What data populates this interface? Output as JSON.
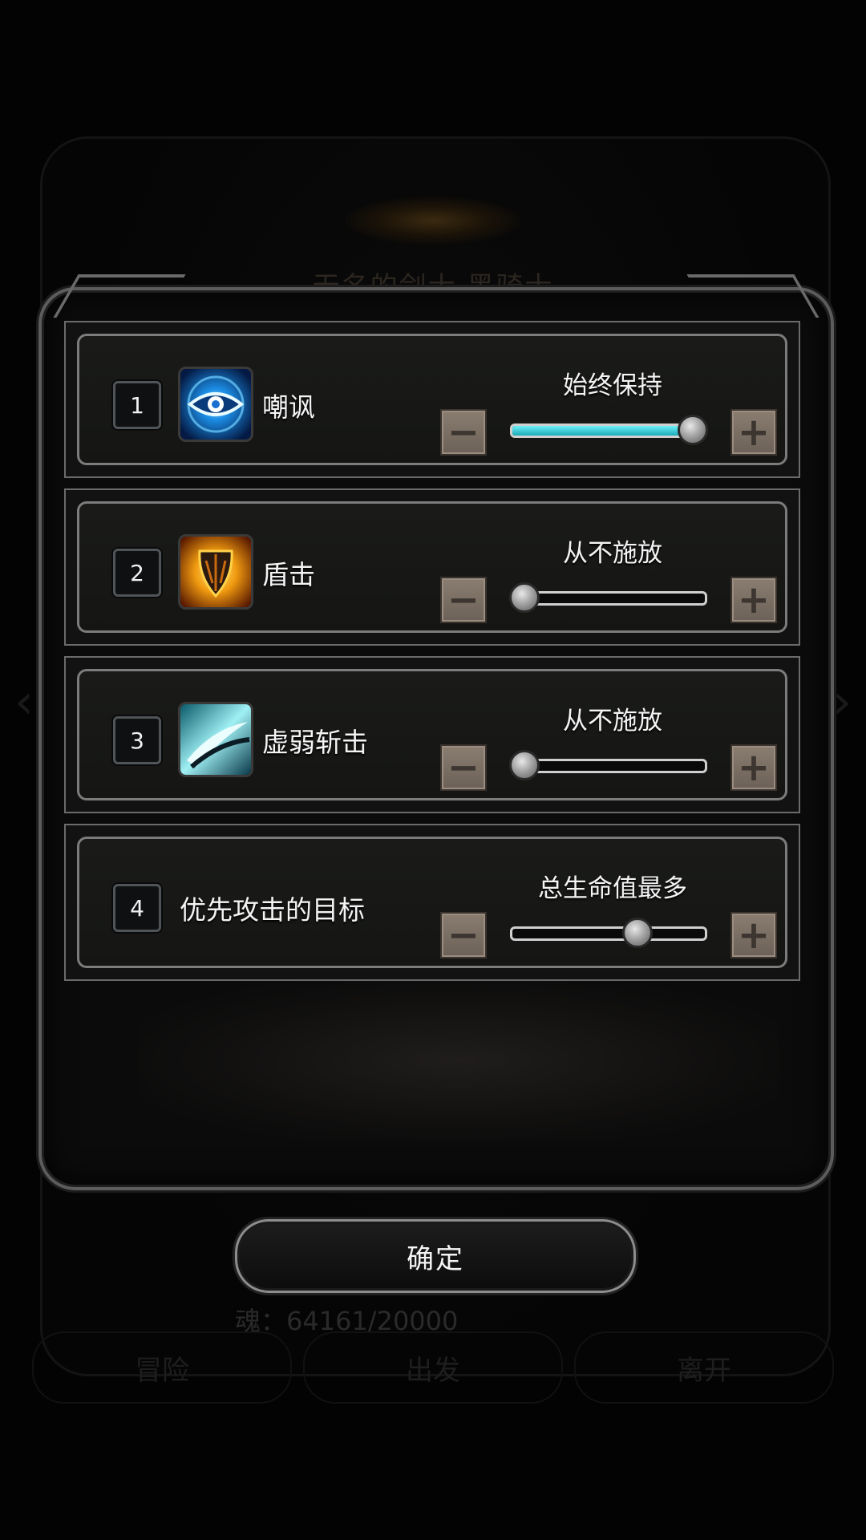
{
  "background": {
    "title": "无名的剑士 黑骑士",
    "souls": "魂：64161/20000",
    "nav": [
      "冒险",
      "出发",
      "离开"
    ]
  },
  "settings": [
    {
      "number": "1",
      "icon": "taunt-eye-icon",
      "name": "嘲讽",
      "value_label": "始终保持",
      "level": 1.0
    },
    {
      "number": "2",
      "icon": "shield-bash-icon",
      "name": "盾击",
      "value_label": "从不施放",
      "level": 0.0
    },
    {
      "number": "3",
      "icon": "weak-slash-icon",
      "name": "虚弱斩击",
      "value_label": "从不施放",
      "level": 0.0
    },
    {
      "number": "4",
      "icon": null,
      "name": "优先攻击的目标",
      "value_label": "总生命值最多",
      "level": 0.67
    }
  ],
  "buttons": {
    "minus": "−",
    "plus": "+",
    "confirm": "确定"
  },
  "colors": {
    "slider_fill": "#2fd0dc",
    "stepper": "#7a6e63"
  }
}
